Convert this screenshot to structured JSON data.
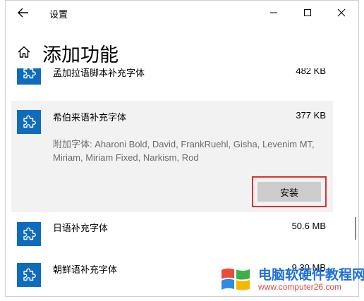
{
  "window": {
    "title": "设置",
    "back_icon": "back-arrow-icon",
    "controls": [
      "minimize-icon",
      "maximize-icon",
      "close-icon"
    ]
  },
  "page": {
    "home_icon": "home-icon",
    "title": "添加功能"
  },
  "items": [
    {
      "name": "孟加拉语脚本补充字体",
      "size": "482 KB",
      "icon": "puzzle-icon"
    },
    {
      "name": "希伯来语补充字体",
      "size": "377 KB",
      "icon": "puzzle-icon",
      "description": "附加字体: Aharoni Bold, David, FrankRuehl, Gisha, Levenim MT, Miriam, Miriam Fixed, Narkism, Rod",
      "install_label": "安装"
    },
    {
      "name": "日语补充字体",
      "size": "50.6 MB",
      "icon": "puzzle-icon"
    },
    {
      "name": "朝鲜语补充字体",
      "size": "9.30 MB",
      "icon": "puzzle-icon"
    }
  ],
  "watermark": {
    "title": "电脑软硬件教程网",
    "url": "www.computer26.com"
  },
  "colors": {
    "icon_tile": "#0f6cbd",
    "selected_bg": "#f2f2f2",
    "button_bg": "#cccccc",
    "highlight": "#e03030",
    "watermark_title": "#1e6fd9",
    "watermark_url": "#e1473b"
  }
}
